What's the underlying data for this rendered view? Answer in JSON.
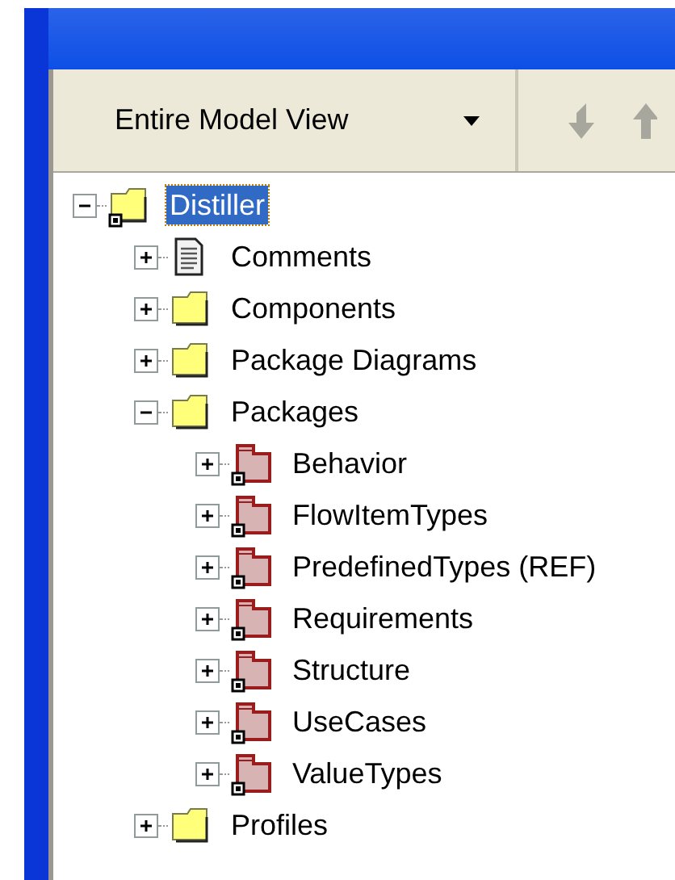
{
  "view_selector": {
    "value": "Entire Model View"
  },
  "tree": [
    {
      "label": "Distiller",
      "kind": "folder",
      "linked": true,
      "expanded": true,
      "selected": true,
      "children": [
        {
          "label": "Comments",
          "kind": "document",
          "linked": false,
          "expanded": false,
          "selected": false
        },
        {
          "label": "Components",
          "kind": "folder",
          "linked": false,
          "expanded": false,
          "selected": false
        },
        {
          "label": "Package Diagrams",
          "kind": "folder",
          "linked": false,
          "expanded": false,
          "selected": false
        },
        {
          "label": "Packages",
          "kind": "folder",
          "linked": false,
          "expanded": true,
          "selected": false,
          "children": [
            {
              "label": "Behavior",
              "kind": "package",
              "linked": true,
              "expanded": false,
              "selected": false
            },
            {
              "label": "FlowItemTypes",
              "kind": "package",
              "linked": true,
              "expanded": false,
              "selected": false
            },
            {
              "label": "PredefinedTypes (REF)",
              "kind": "package",
              "linked": true,
              "expanded": false,
              "selected": false
            },
            {
              "label": "Requirements",
              "kind": "package",
              "linked": true,
              "expanded": false,
              "selected": false
            },
            {
              "label": "Structure",
              "kind": "package",
              "linked": true,
              "expanded": false,
              "selected": false
            },
            {
              "label": "UseCases",
              "kind": "package",
              "linked": true,
              "expanded": false,
              "selected": false
            },
            {
              "label": "ValueTypes",
              "kind": "package",
              "linked": true,
              "expanded": false,
              "selected": false
            }
          ]
        },
        {
          "label": "Profiles",
          "kind": "folder",
          "linked": false,
          "expanded": false,
          "selected": false
        }
      ]
    }
  ]
}
